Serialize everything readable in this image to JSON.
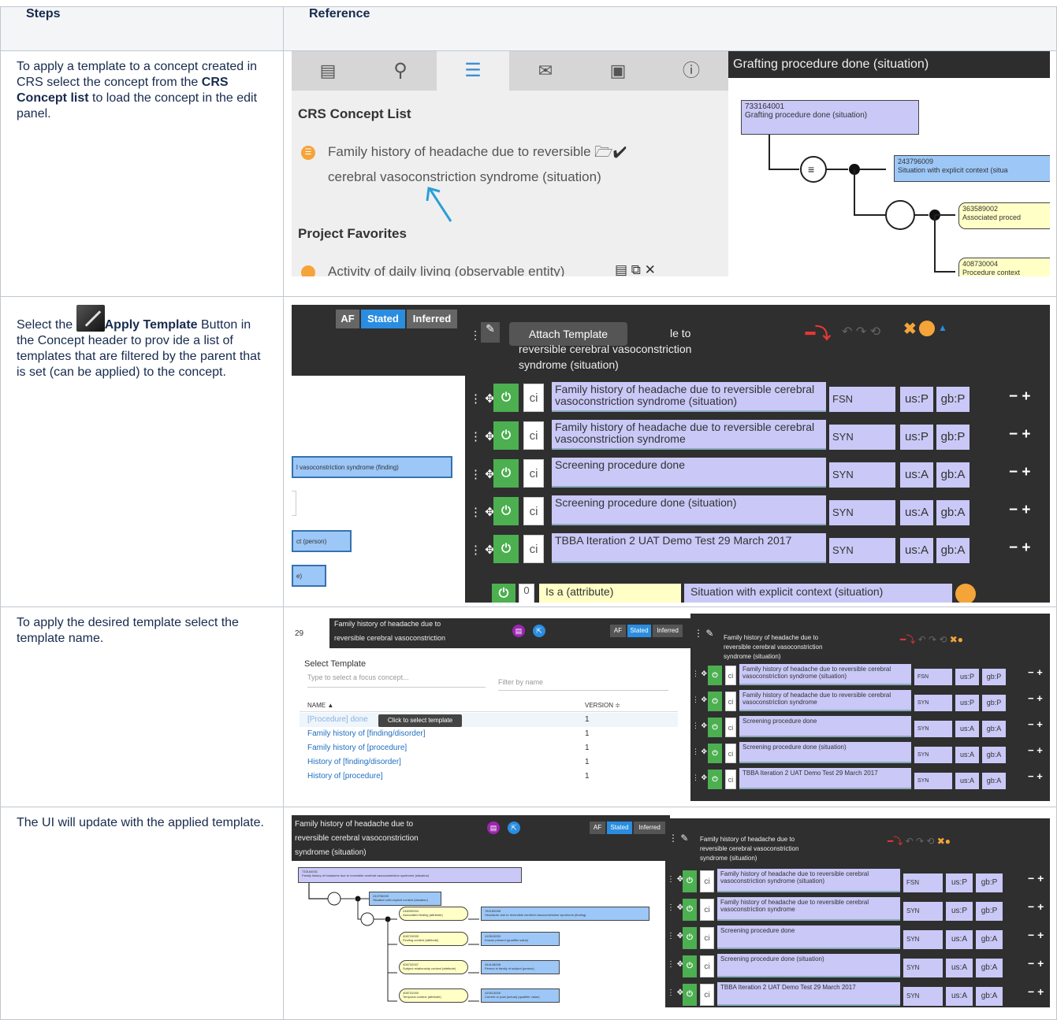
{
  "table": {
    "headers": [
      "Steps",
      "Reference"
    ],
    "rows": [
      {
        "step_parts": [
          "To apply a template to a concept created in CRS select the concept from the ",
          "CRS Concept list",
          " to load the concept in the edit panel."
        ]
      },
      {
        "step_parts": [
          "Select the ",
          "Apply Template",
          " Button in the Concept header to prov ide a list of templates that are filtered by the parent that is set (can be applied) to the concept."
        ]
      },
      {
        "step_parts": [
          "To apply the desired template select the template name."
        ]
      },
      {
        "step_parts": [
          "The UI will update with the applied template."
        ]
      }
    ]
  },
  "shot1": {
    "list_title": "CRS Concept List",
    "concept_line1": "Family history of headache due to reversible",
    "concept_line2": "cerebral vasoconstriction syndrome (situation)",
    "favorites_title": "Project Favorites",
    "favorite_item": "Activity of daily living (observable entity)",
    "diagram_title": "Grafting procedure done (situation)",
    "node1_id": "733164001",
    "node1_label": "Grafting procedure done (situation)",
    "node2_id": "243796009",
    "node2_label": "Situation with explicit context (situa",
    "node3_id": "363589002",
    "node3_label": "Associated proced",
    "node4_id": "408730004",
    "node4_label": "Procedure context"
  },
  "shot2": {
    "btn_af": "AF",
    "btn_stated": "Stated",
    "btn_inferred": "Inferred",
    "tooltip": "Attach Template",
    "header_text1": "le to",
    "header_text2": "reversible cerebral vasoconstriction",
    "header_text3": "syndrome (situation)",
    "left_node1": "l vasoconstriction syndrome (finding)",
    "left_node2": "ct (person)",
    "left_node3": "e)",
    "descriptions": [
      {
        "term": "Family history of headache due to reversible cerebral vasoconstriction syndrome (situation)",
        "type": "FSN",
        "us": "us:P",
        "gb": "gb:P"
      },
      {
        "term": "Family history of headache due to reversible cerebral vasoconstriction syndrome",
        "type": "SYN",
        "us": "us:P",
        "gb": "gb:P"
      },
      {
        "term": "Screening procedure done",
        "type": "SYN",
        "us": "us:A",
        "gb": "gb:A"
      },
      {
        "term": "Screening procedure done (situation)",
        "type": "SYN",
        "us": "us:A",
        "gb": "gb:A"
      },
      {
        "term": "TBBA Iteration 2 UAT Demo Test 29 March 2017",
        "type": "SYN",
        "us": "us:A",
        "gb": "gb:A"
      }
    ],
    "ci": "ci",
    "rel_group": "0",
    "rel_type": "Is a (attribute)",
    "rel_target": "Situation with explicit context (situation)"
  },
  "shot3": {
    "header_num": "29",
    "header_line1": "Family history of headache due to",
    "header_line2": "reversible cerebral vasoconstriction",
    "dialog_title": "Select Template",
    "focus_placeholder": "Type to select a focus concept...",
    "filter_placeholder": "Filter by name",
    "col_name": "NAME ▲",
    "col_version": "VERSION ≑",
    "templates": [
      {
        "name": "[Procedure] done",
        "version": "1"
      },
      {
        "name": "Family history of [finding/disorder]",
        "version": "1"
      },
      {
        "name": "Family history of [procedure]",
        "version": "1"
      },
      {
        "name": "History of [finding/disorder]",
        "version": "1"
      },
      {
        "name": "History of [procedure]",
        "version": "1"
      }
    ],
    "tooltip": "Click to select template",
    "btn_af": "AF",
    "btn_stated": "Stated",
    "btn_inferred": "Inferred",
    "right_header1": "Family history of headache due to",
    "right_header2": "reversible cerebral vasoconstriction",
    "right_header3": "syndrome (situation)"
  },
  "shot4": {
    "header_line1": "Family history of headache due to",
    "header_line2": "reversible cerebral vasoconstriction",
    "header_line3": "syndrome (situation)",
    "btn_af": "AF",
    "btn_stated": "Stated",
    "btn_inferred": "Inferred",
    "root_id": "733164001",
    "root_label": "Family history of headache due to reversible cerebral vasoconstriction syndrome (situation)",
    "n_sit_id": "243796009",
    "n_sit_label": "Situation with explicit context (situation)",
    "attrs": [
      {
        "id": "246090004",
        "attr": "Associated finding (attribute)",
        "vid": "782180008",
        "value": "Headache due to reversible cerebral vasoconstriction syndrome (finding)"
      },
      {
        "id": "408729009",
        "attr": "Finding context (attribute)",
        "vid": "410515003",
        "value": "Known present (qualifier value)"
      },
      {
        "id": "408732007",
        "attr": "Subject relationship context (attribute)",
        "vid": "444148008",
        "value": "Person in family of subject (person)"
      },
      {
        "id": "408731000",
        "attr": "Temporal context (attribute)",
        "vid": "410513005",
        "value": "Current or past (actual) (qualifier value)"
      }
    ],
    "right_header1": "Family history of headache due to",
    "right_header2": "reversible cerebral vasoconstriction",
    "right_header3": "syndrome (situation)"
  }
}
